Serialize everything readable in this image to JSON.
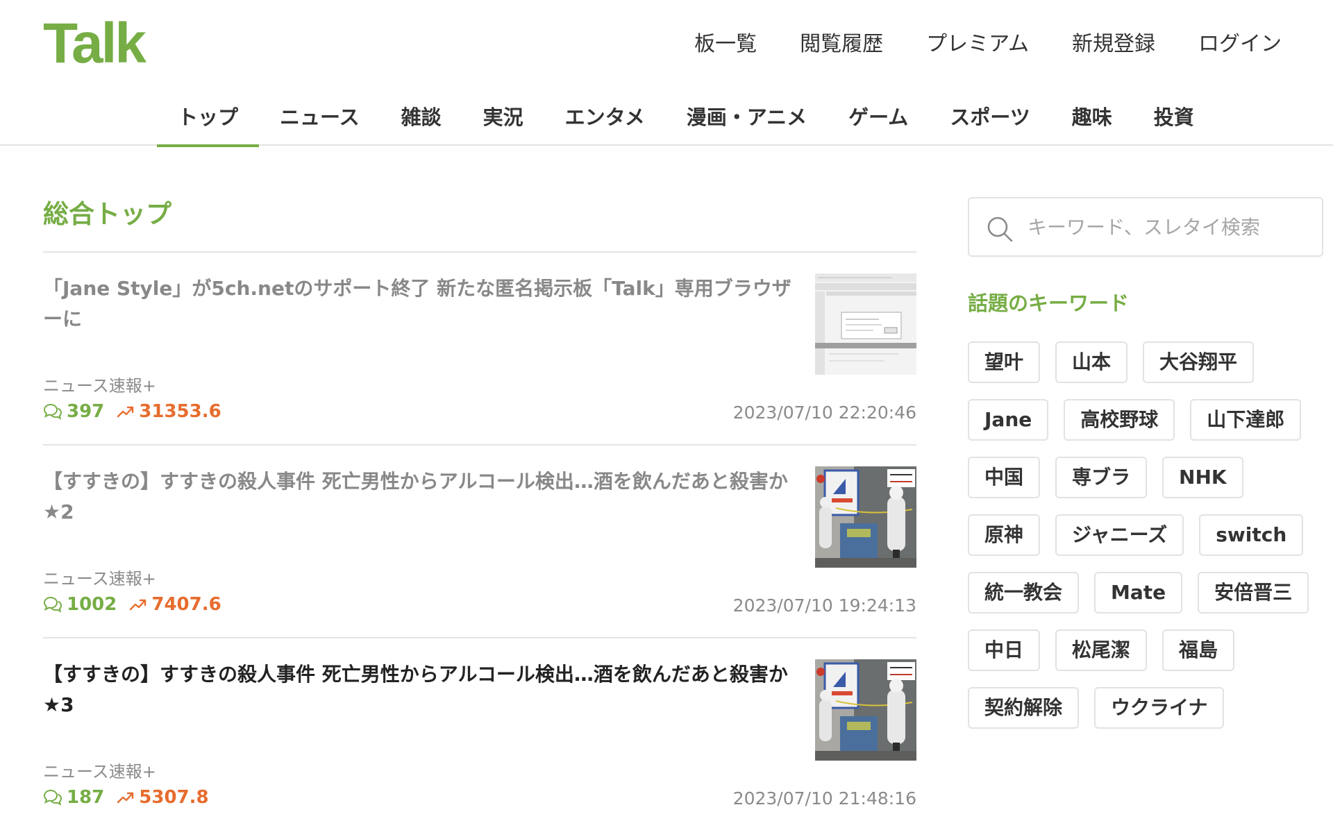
{
  "site": {
    "logo": "Talk"
  },
  "top_nav": [
    "板一覧",
    "閲覧履歴",
    "プレミアム",
    "新規登録",
    "ログイン"
  ],
  "categories": [
    {
      "label": "トップ",
      "active": true
    },
    {
      "label": "ニュース",
      "active": false
    },
    {
      "label": "雑談",
      "active": false
    },
    {
      "label": "実況",
      "active": false
    },
    {
      "label": "エンタメ",
      "active": false
    },
    {
      "label": "漫画・アニメ",
      "active": false
    },
    {
      "label": "ゲーム",
      "active": false
    },
    {
      "label": "スポーツ",
      "active": false
    },
    {
      "label": "趣味",
      "active": false
    },
    {
      "label": "投資",
      "active": false
    }
  ],
  "main": {
    "title": "総合トップ",
    "threads": [
      {
        "title": "「Jane Style」が5ch.netのサポート終了 新たな匿名掲示板「Talk」専用ブラウザーに",
        "board": "ニュース速報+",
        "res_count": "397",
        "momentum": "31353.6",
        "date": "2023/07/10 22:20:46",
        "read": true,
        "thumb_type": "screenshot"
      },
      {
        "title": "【すすきの】すすきの殺人事件 死亡男性からアルコール検出…酒を飲んだあと殺害か ★2",
        "board": "ニュース速報+",
        "res_count": "1002",
        "momentum": "7407.6",
        "date": "2023/07/10 19:24:13",
        "read": true,
        "thumb_type": "photo"
      },
      {
        "title": "【すすきの】すすきの殺人事件 死亡男性からアルコール検出…酒を飲んだあと殺害か ★3",
        "board": "ニュース速報+",
        "res_count": "187",
        "momentum": "5307.8",
        "date": "2023/07/10 21:48:16",
        "read": false,
        "thumb_type": "photo"
      }
    ]
  },
  "sidebar": {
    "search_placeholder": "キーワード、スレタイ検索",
    "keywords_title": "話題のキーワード",
    "keywords": [
      "望叶",
      "山本",
      "大谷翔平",
      "Jane",
      "高校野球",
      "山下達郎",
      "中国",
      "専ブラ",
      "NHK",
      "原神",
      "ジャニーズ",
      "switch",
      "統一教会",
      "Mate",
      "安倍晋三",
      "中日",
      "松尾潔",
      "福島",
      "契約解除",
      "ウクライナ"
    ]
  },
  "colors": {
    "brand": "#76ad45",
    "momentum": "#e76c2e",
    "border": "#e4e4e4"
  },
  "icons": {
    "res": "speech-bubbles-icon",
    "momentum": "trend-up-icon",
    "search": "search-icon"
  }
}
